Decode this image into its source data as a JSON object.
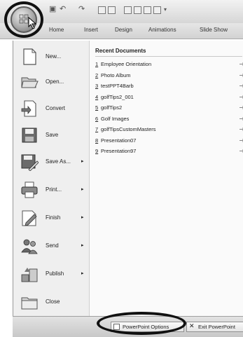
{
  "quick_access": {
    "undo": "↶",
    "redo": "↷"
  },
  "ribbon": {
    "tabs": [
      "Home",
      "Insert",
      "Design",
      "Animations",
      "Slide Show"
    ]
  },
  "menu": {
    "left_items": [
      {
        "label": "New...",
        "icon": "new-document-icon",
        "has_submenu": false
      },
      {
        "label": "Open...",
        "icon": "open-folder-icon",
        "has_submenu": false
      },
      {
        "label": "Convert",
        "icon": "convert-icon",
        "has_submenu": false
      },
      {
        "label": "Save",
        "icon": "save-disk-icon",
        "has_submenu": false
      },
      {
        "label": "Save As...",
        "icon": "save-as-icon",
        "has_submenu": true,
        "arrow": "▸"
      },
      {
        "label": "Print...",
        "icon": "printer-icon",
        "has_submenu": true,
        "arrow": "▸"
      },
      {
        "label": "Finish",
        "icon": "finish-pen-icon",
        "has_submenu": true,
        "arrow": "▸"
      },
      {
        "label": "Send",
        "icon": "send-people-icon",
        "has_submenu": true,
        "arrow": "▸"
      },
      {
        "label": "Publish",
        "icon": "publish-icon",
        "has_submenu": true,
        "arrow": "▸"
      },
      {
        "label": "Close",
        "icon": "close-folder-icon",
        "has_submenu": false
      }
    ],
    "recent_title": "Recent Documents",
    "recent_documents": [
      {
        "num": "1",
        "name": "Employee Orientation"
      },
      {
        "num": "2",
        "name": "Photo Album"
      },
      {
        "num": "3",
        "name": "testPPT4Barb"
      },
      {
        "num": "4",
        "name": "golfTips2_001"
      },
      {
        "num": "5",
        "name": "golfTips2"
      },
      {
        "num": "6",
        "name": "Golf Images"
      },
      {
        "num": "7",
        "name": "golfTipsCustomMasters"
      },
      {
        "num": "8",
        "name": "Presentation07"
      },
      {
        "num": "9",
        "name": "Presentation97"
      }
    ]
  },
  "bottom_bar": {
    "options_label": "PowerPoint Options",
    "exit_label": "Exit PowerPoint"
  },
  "colors": {
    "highlight_ring": "#111111",
    "menu_bg": "#f4f4f4"
  }
}
